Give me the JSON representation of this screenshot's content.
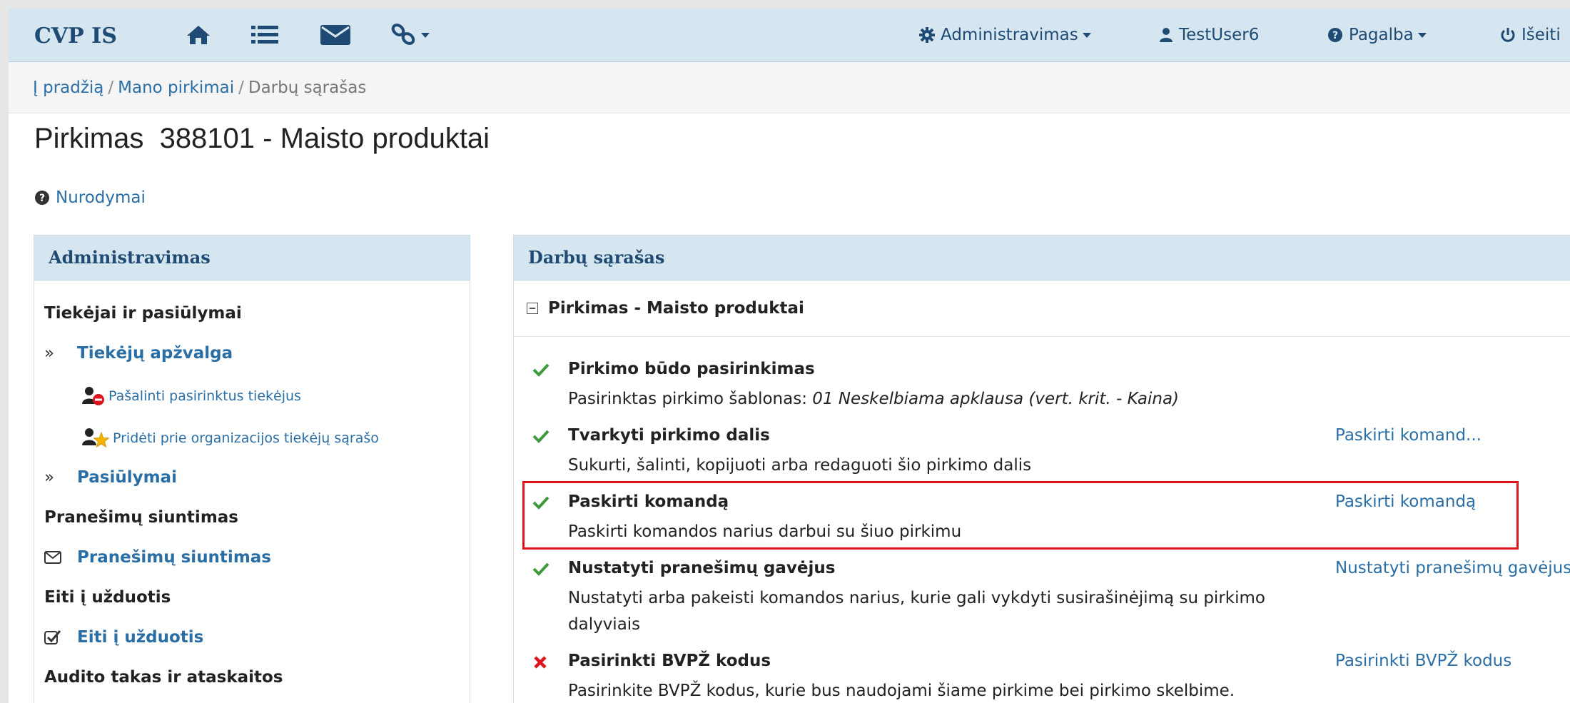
{
  "navbar": {
    "brand": "CVP IS",
    "icons": [
      "home-icon",
      "list-icon",
      "envelope-icon",
      "link-icon"
    ],
    "admin_label": "Administravimas",
    "user_label": "TestUser6",
    "help_label": "Pagalba",
    "logout_label": "Išeiti"
  },
  "breadcrumb": {
    "home": "Į pradžią",
    "purchases": "Mano pirkimai",
    "current": "Darbų sąrašas"
  },
  "page_title": "Pirkimas  388101 - Maisto produktai",
  "instructions_label": "Nurodymai",
  "sidebar": {
    "title": "Administravimas",
    "section_suppliers": "Tiekėjai ir pasiūlymai",
    "link_supplier_overview": "Tiekėjų apžvalga",
    "sub_remove_suppliers": "Pašalinti pasirinktus tiekėjus",
    "sub_add_to_org_list": "Pridėti prie organizacijos tiekėjų sąrašo",
    "link_offers": "Pasiūlymai",
    "section_messaging": "Pranešimų siuntimas",
    "link_messaging": "Pranešimų siuntimas",
    "section_tasks": "Eiti į užduotis",
    "link_tasks": "Eiti į užduotis",
    "section_audit": "Audito takas ir ataskaitos"
  },
  "worklist": {
    "title": "Darbų sąrašas",
    "group_title": "Pirkimas - Maisto produktai",
    "tasks": [
      {
        "status": "done",
        "title": "Pirkimo būdo pasirinkimas",
        "desc_prefix": "Pasirinktas pirkimo šablonas: ",
        "desc_italic": "01 Neskelbiama apklausa (vert. krit. - Kaina)",
        "action": ""
      },
      {
        "status": "done",
        "title": "Tvarkyti pirkimo dalis",
        "desc": "Sukurti, šalinti, kopijuoti arba redaguoti šio pirkimo dalis",
        "action": "Paskirti komand..."
      },
      {
        "status": "done",
        "title": "Paskirti komandą",
        "desc": "Paskirti komandos narius darbui su šiuo pirkimu",
        "action": "Paskirti komandą"
      },
      {
        "status": "done",
        "title": "Nustatyti pranešimų gavėjus",
        "desc": "Nustatyti arba pakeisti komandos narius, kurie gali vykdyti susirašinėjimą su pirkimo dalyviais",
        "action": "Nustatyti pranešimų gavėjus"
      },
      {
        "status": "pending",
        "title": "Pasirinkti BVPŽ kodus",
        "desc": "Pasirinkite BVPŽ kodus, kurie bus naudojami šiame pirkime bei pirkimo skelbime.",
        "action": "Pasirinkti BVPŽ kodus"
      }
    ]
  },
  "colors": {
    "navbar_bg": "#d5e6f0",
    "link": "#2a6ea6",
    "check_green": "#3c9a3c",
    "cross_red": "#e0141e",
    "highlight_border": "#e0141e"
  }
}
